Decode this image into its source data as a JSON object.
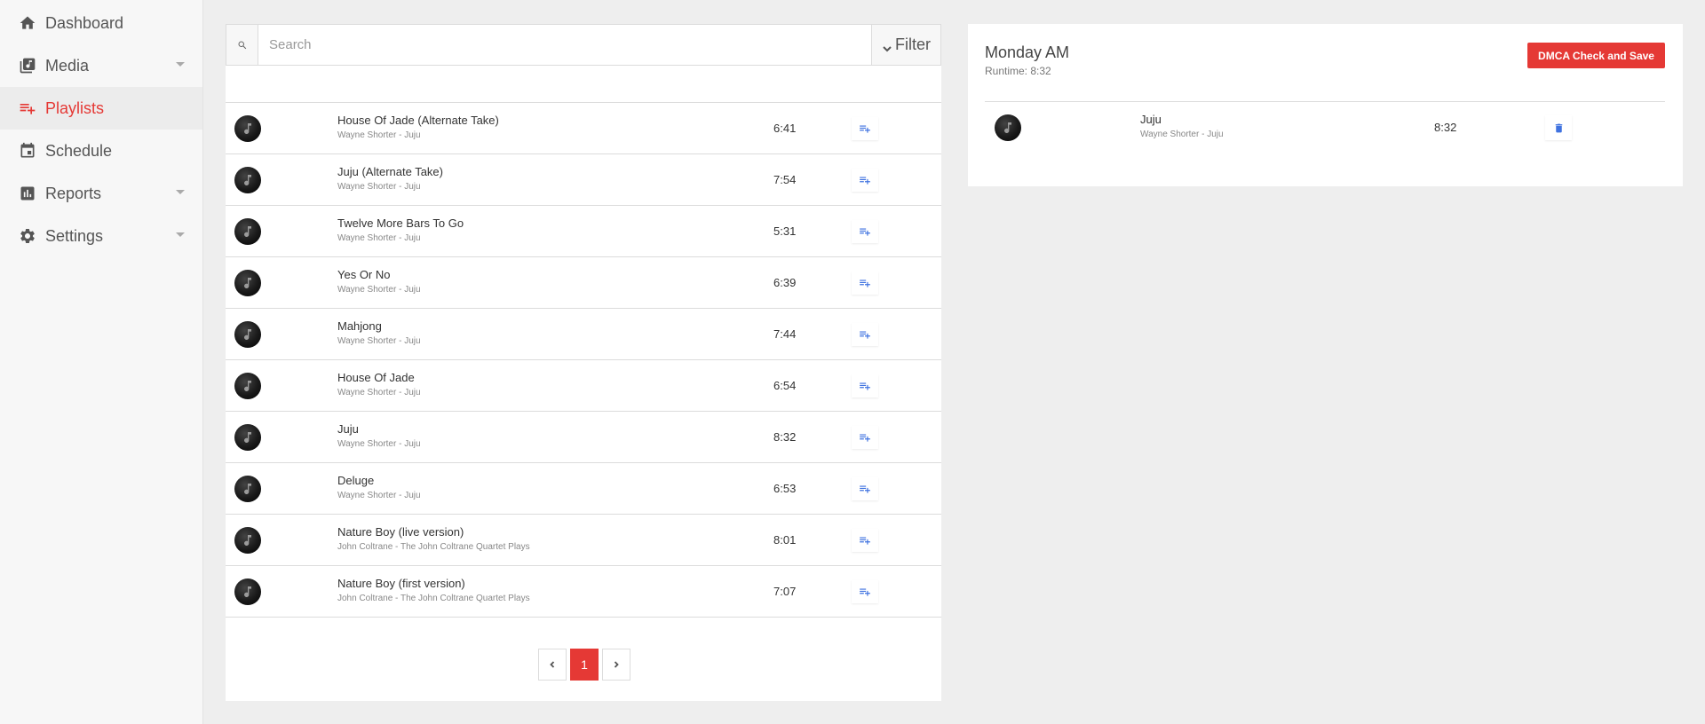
{
  "sidebar": {
    "items": [
      {
        "label": "Dashboard",
        "icon": "home-icon"
      },
      {
        "label": "Media",
        "icon": "media-library-icon"
      },
      {
        "label": "Playlists",
        "icon": "playlist-add-icon"
      },
      {
        "label": "Schedule",
        "icon": "calendar-icon"
      },
      {
        "label": "Reports",
        "icon": "bar-chart-icon"
      },
      {
        "label": "Settings",
        "icon": "gear-icon"
      }
    ]
  },
  "search": {
    "placeholder": "Search",
    "value": "",
    "filter_label": "Filter"
  },
  "tracks": [
    {
      "title": "House Of Jade (Alternate Take)",
      "subtitle": "Wayne Shorter - Juju",
      "duration": "6:41"
    },
    {
      "title": "Juju (Alternate Take)",
      "subtitle": "Wayne Shorter - Juju",
      "duration": "7:54"
    },
    {
      "title": "Twelve More Bars To Go",
      "subtitle": "Wayne Shorter - Juju",
      "duration": "5:31"
    },
    {
      "title": "Yes Or No",
      "subtitle": "Wayne Shorter - Juju",
      "duration": "6:39"
    },
    {
      "title": "Mahjong",
      "subtitle": "Wayne Shorter - Juju",
      "duration": "7:44"
    },
    {
      "title": "House Of Jade",
      "subtitle": "Wayne Shorter - Juju",
      "duration": "6:54"
    },
    {
      "title": "Juju",
      "subtitle": "Wayne Shorter - Juju",
      "duration": "8:32"
    },
    {
      "title": "Deluge",
      "subtitle": "Wayne Shorter - Juju",
      "duration": "6:53"
    },
    {
      "title": "Nature Boy (live version)",
      "subtitle": "John Coltrane - The John Coltrane Quartet Plays",
      "duration": "8:01"
    },
    {
      "title": "Nature Boy (first version)",
      "subtitle": "John Coltrane - The John Coltrane Quartet Plays",
      "duration": "7:07"
    }
  ],
  "pagination": {
    "current": "1"
  },
  "playlist": {
    "title": "Monday AM",
    "runtime": "Runtime: 8:32",
    "save_label": "DMCA Check and Save",
    "items": [
      {
        "title": "Juju",
        "subtitle": "Wayne Shorter - Juju",
        "duration": "8:32"
      }
    ]
  },
  "colors": {
    "accent": "#e53935",
    "action_icon": "#3f72e0",
    "background": "#eeeeee",
    "sidebar": "#f7f7f7"
  }
}
